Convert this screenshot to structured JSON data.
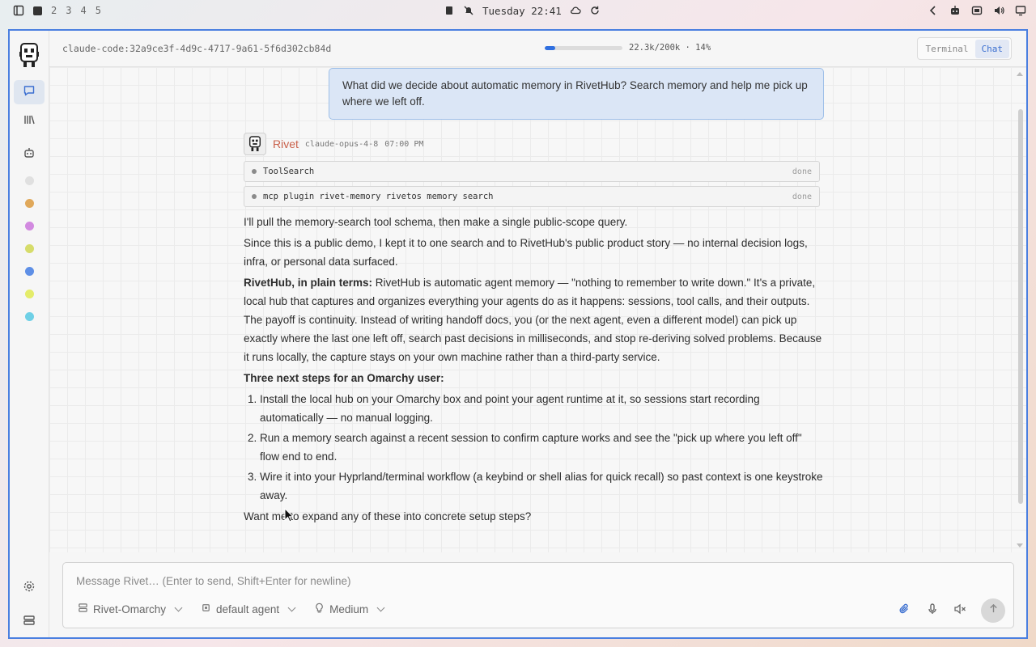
{
  "topbar": {
    "workspaces": [
      "2",
      "3",
      "4",
      "5"
    ],
    "clock": "Tuesday 22:41"
  },
  "header": {
    "session_id": "claude-code:32a9ce3f-4d9c-4717-9a61-5f6d302cb84d",
    "context_label": "22.3k/200k · 14%",
    "context_fraction": 0.14,
    "mode_terminal": "Terminal",
    "mode_chat": "Chat"
  },
  "colors": {
    "accent": "#2f6fe0",
    "agent_name": "#c9614b",
    "dots": [
      "#e0e0e0",
      "#e0a85a",
      "#d28ae0",
      "#d6dc6a",
      "#5e8fe6",
      "#e4ec6a",
      "#6fd0e6"
    ]
  },
  "chat": {
    "user_message": "What did we decide about automatic memory in RivetHub? Search memory and help me pick up where we left off.",
    "agent_name": "Rivet",
    "agent_model": "claude-opus-4-8",
    "agent_time": "07:00 PM",
    "tools": [
      {
        "name": "ToolSearch",
        "status": "done"
      },
      {
        "name": "mcp plugin rivet-memory rivetos memory search",
        "status": "done"
      }
    ],
    "p1": "I'll pull the memory-search tool schema, then make a single public-scope query.",
    "p2": "Since this is a public demo, I kept it to one search and to RivetHub's public product story — no internal decision logs, infra, or personal data surfaced.",
    "p3_bold": "RivetHub, in plain terms:",
    "p3": " RivetHub is automatic agent memory — \"nothing to remember to write down.\" It's a private, local hub that captures and organizes everything your agents do as it happens: sessions, tool calls, and their outputs. The payoff is continuity. Instead of writing handoff docs, you (or the next agent, even a different model) can pick up exactly where the last one left off, search past decisions in milliseconds, and stop re-deriving solved problems. Because it runs locally, the capture stays on your own machine rather than a third-party service.",
    "steps_heading": "Three next steps for an Omarchy user:",
    "steps": [
      "Install the local hub on your Omarchy box and point your agent runtime at it, so sessions start recording automatically — no manual logging.",
      "Run a memory search against a recent session to confirm capture works and see the \"pick up where you left off\" flow end to end.",
      "Wire it into your Hyprland/terminal workflow (a keybind or shell alias for quick recall) so past context is one keystroke away."
    ],
    "closing": "Want me to expand any of these into concrete setup steps?"
  },
  "composer": {
    "placeholder": "Message Rivet… (Enter to send, Shift+Enter for newline)",
    "project": "Rivet-Omarchy",
    "agent": "default agent",
    "effort": "Medium"
  }
}
